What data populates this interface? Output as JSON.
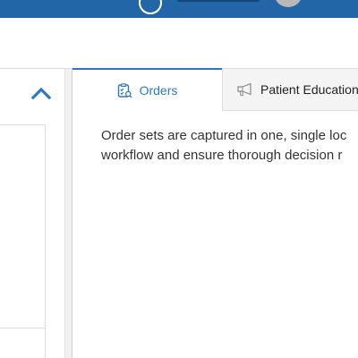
{
  "topbar": {
    "help_icon": "help-circle-icon",
    "account_icon": "user-avatar-icon"
  },
  "left_panel": {
    "collapse_icon": "chevron-up-icon"
  },
  "tabs": [
    {
      "label": "Orders",
      "icon": "order-checklist-icon",
      "active": true
    },
    {
      "label": "Patient Education",
      "icon": "megaphone-icon",
      "active": false
    }
  ],
  "content": {
    "lines": [
      "Order sets are captured in one, single loc",
      "workflow and ensure thorough decision r"
    ]
  },
  "colors": {
    "topbar": "#2266a8",
    "accent": "#2b78c5",
    "text": "#333333",
    "border": "#dddddd"
  }
}
